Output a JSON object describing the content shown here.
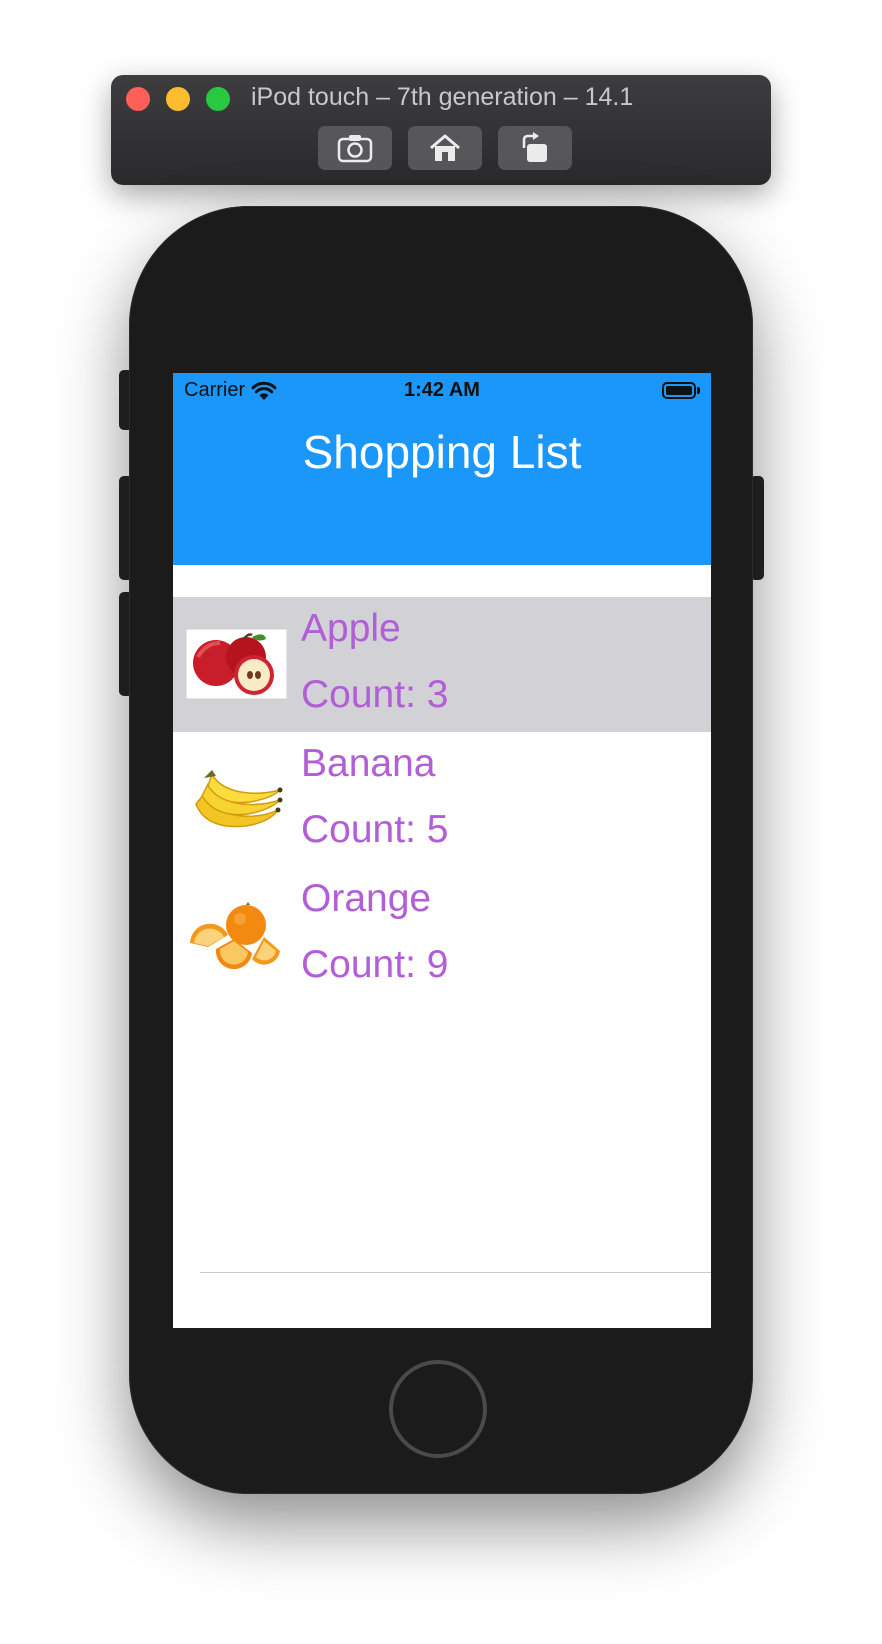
{
  "simulator": {
    "title": "iPod touch – 7th generation – 14.1",
    "buttons": [
      {
        "name": "screenshot",
        "icon": "camera-icon"
      },
      {
        "name": "home",
        "icon": "home-icon"
      },
      {
        "name": "rotate",
        "icon": "rotate-icon"
      }
    ]
  },
  "status_bar": {
    "carrier": "Carrier",
    "time": "1:42 AM",
    "wifi_icon": "wifi-icon",
    "battery_icon": "battery-icon",
    "battery_level": 1.0
  },
  "nav": {
    "title": "Shopping List",
    "background_color": "#1a97f8"
  },
  "items": [
    {
      "name": "Apple",
      "count_label": "Count: 3",
      "image": "apple-image",
      "selected": true
    },
    {
      "name": "Banana",
      "count_label": "Count: 5",
      "image": "banana-image",
      "selected": false
    },
    {
      "name": "Orange",
      "count_label": "Count: 9",
      "image": "orange-image",
      "selected": false
    }
  ],
  "colors": {
    "item_text": "#b25ed6",
    "selected_row": "#d1d1d6",
    "separator": "#c8c7cc"
  }
}
